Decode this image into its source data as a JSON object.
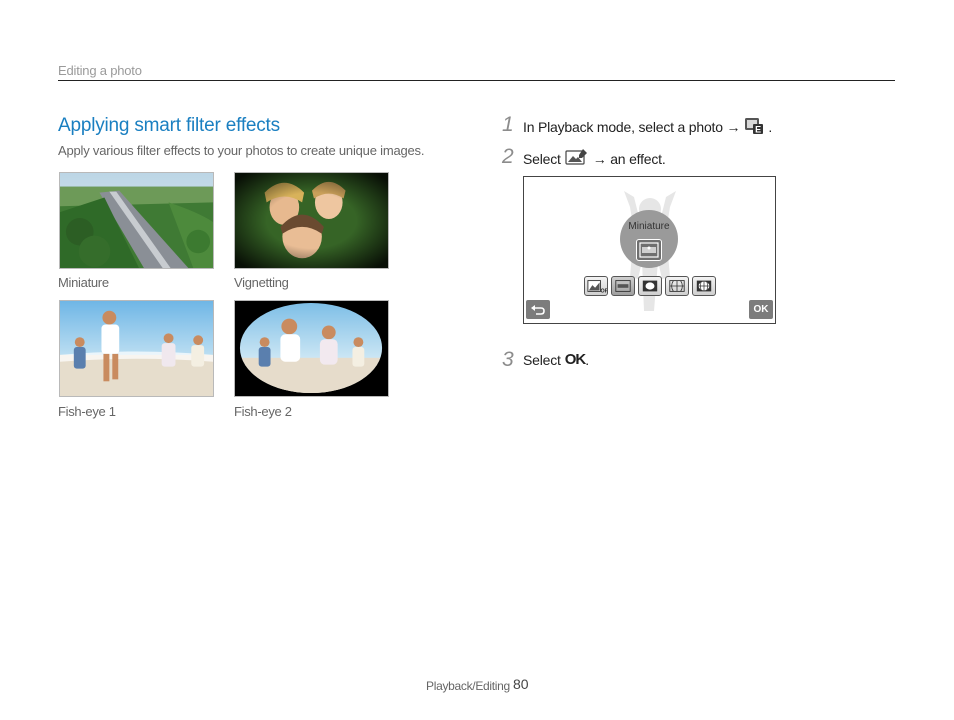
{
  "header": {
    "section": "Editing a photo"
  },
  "section": {
    "title": "Applying smart filter effects",
    "description": "Apply various filter effects to your photos to create unique images."
  },
  "examples": [
    {
      "caption": "Miniature"
    },
    {
      "caption": "Vignetting"
    },
    {
      "caption": "Fish-eye 1"
    },
    {
      "caption": "Fish-eye 2"
    }
  ],
  "steps": [
    {
      "number": "1",
      "text_before": "In Playback mode, select a photo →",
      "text_after": "."
    },
    {
      "number": "2",
      "text_before": "Select",
      "text_after": "→ an effect."
    },
    {
      "number": "3",
      "text_before": "Select",
      "ok_label": "OK",
      "text_after": "."
    }
  ],
  "camera_screen": {
    "selected_effect_label": "Miniature",
    "ok_button_label": "OK"
  },
  "footer": {
    "label": "Playback/Editing",
    "page": "80"
  },
  "colors": {
    "accent": "#1a7fc1",
    "rule": "#222222"
  }
}
